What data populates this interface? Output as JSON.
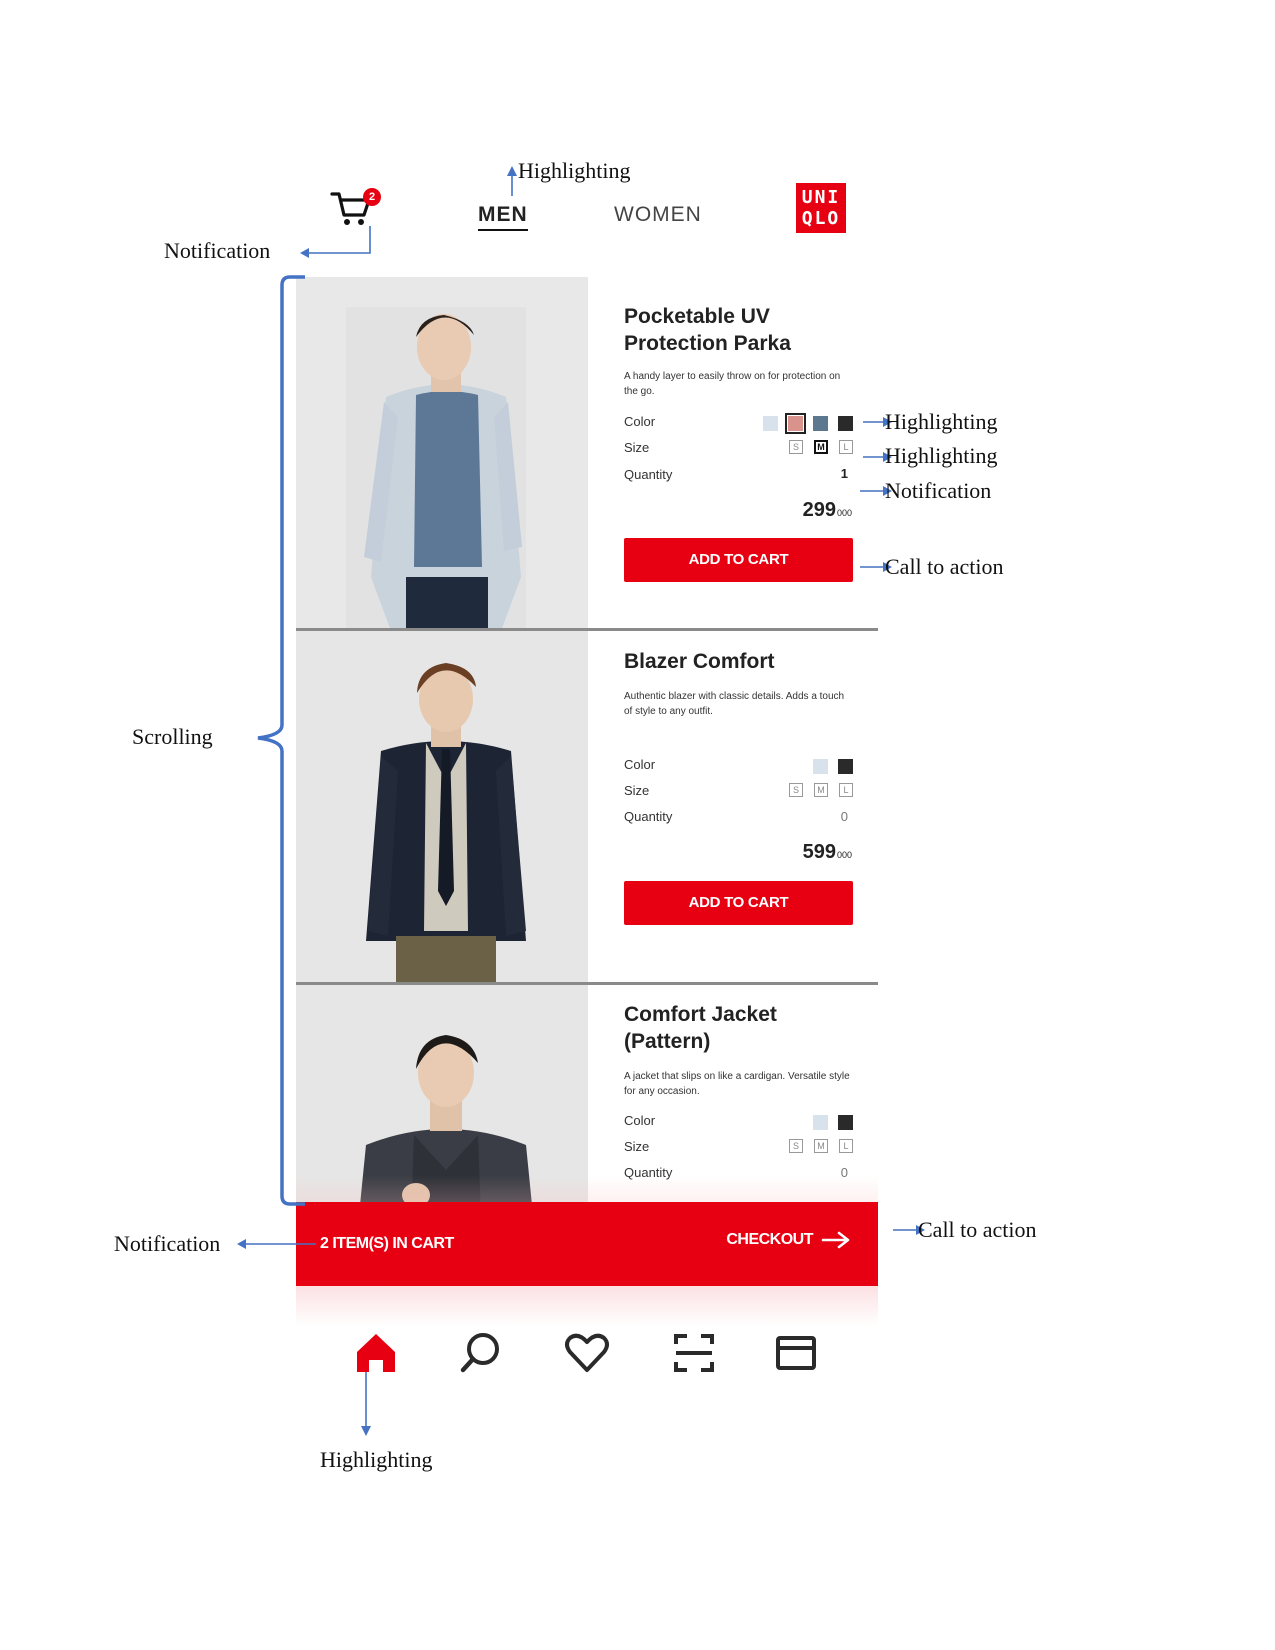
{
  "header": {
    "cart_badge": "2",
    "tabs": [
      {
        "label": "MEN"
      },
      {
        "label": "WOMEN"
      }
    ],
    "logo": {
      "line1": "UNI",
      "line2": "QLO"
    }
  },
  "products": [
    {
      "title": "Pocketable UV Protection Parka",
      "description": "A handy layer to easily throw on for protection on the go.",
      "color_label": "Color",
      "size_label": "Size",
      "quantity_label": "Quantity",
      "quantity": "1",
      "price": "299",
      "price_suffix": "000",
      "cta": "ADD TO CART",
      "colors": [
        "#d8e2ec",
        "#d9938c",
        "#5c7790",
        "#2a2a2a"
      ],
      "selected_color": 1,
      "sizes": [
        "S",
        "M",
        "L"
      ],
      "selected_size": 1
    },
    {
      "title": "Blazer Comfort",
      "description": "Authentic blazer with classic details. Adds a touch of style to any outfit.",
      "color_label": "Color",
      "size_label": "Size",
      "quantity_label": "Quantity",
      "quantity": "0",
      "price": "599",
      "price_suffix": "000",
      "cta": "ADD TO CART",
      "colors": [
        "#d8e2ec",
        "#2a2a2a"
      ],
      "sizes": [
        "S",
        "M",
        "L"
      ]
    },
    {
      "title": "Comfort Jacket (Pattern)",
      "description": "A jacket that slips on like a cardigan. Versatile style for any occasion.",
      "color_label": "Color",
      "size_label": "Size",
      "quantity_label": "Quantity",
      "quantity": "0",
      "colors": [
        "#d8e2ec",
        "#2a2a2a"
      ],
      "sizes": [
        "S",
        "M",
        "L"
      ]
    }
  ],
  "cart_bar": {
    "count_text": "2 ITEM(S) IN CART",
    "checkout_label": "CHECKOUT"
  },
  "bottom_nav": [
    {
      "icon": "home-icon",
      "active": true
    },
    {
      "icon": "search-icon"
    },
    {
      "icon": "heart-icon"
    },
    {
      "icon": "scan-icon"
    },
    {
      "icon": "card-icon"
    }
  ],
  "annotations": {
    "highlighting": "Highlighting",
    "notification": "Notification",
    "call_to_action": "Call to action",
    "scrolling": "Scrolling"
  },
  "colors": {
    "brand_red": "#e60012",
    "annotation_blue": "#4472c4"
  }
}
